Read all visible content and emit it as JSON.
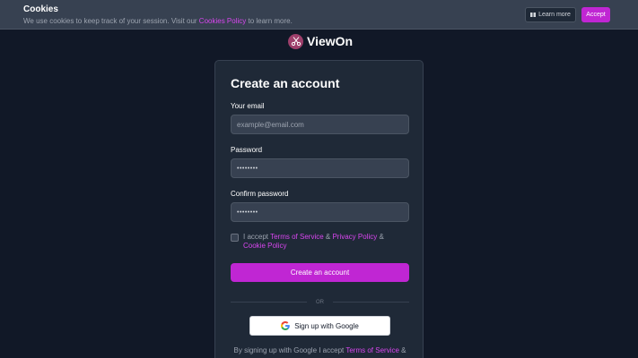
{
  "cookie_banner": {
    "title": "Cookies",
    "text_before": "We use cookies to keep track of your session. Visit our ",
    "policy_link": "Cookies Policy",
    "text_after": " to learn more.",
    "learn_more_label": "Learn more",
    "accept_label": "Accept"
  },
  "brand": {
    "name": "ViewOn",
    "accent_color": "#c026d3"
  },
  "form": {
    "title": "Create an account",
    "email_label": "Your email",
    "email_placeholder": "example@email.com",
    "password_label": "Password",
    "password_value": "••••••••",
    "confirm_label": "Confirm password",
    "confirm_value": "••••••••",
    "terms_prefix": "I accept ",
    "terms_link": "Terms of Service",
    "terms_and1": " & ",
    "privacy_link": "Privacy Policy",
    "terms_and2": " & ",
    "cookie_link": "Cookie Policy",
    "submit_label": "Create an account",
    "or_text": "OR",
    "google_label": "Sign up with Google",
    "legal_prefix": "By signing up with Google I accept ",
    "legal_link": "Terms of Service",
    "legal_suffix": " &"
  },
  "icons": {
    "learn_more": "book-icon",
    "logo": "scissors-logo-icon",
    "google": "google-icon"
  }
}
